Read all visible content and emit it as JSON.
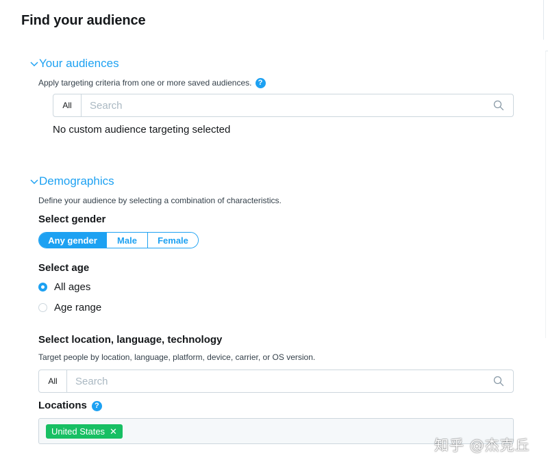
{
  "page": {
    "title": "Find your audience"
  },
  "audiences": {
    "header": "Your audiences",
    "help_text": "Apply targeting criteria from one or more saved audiences.",
    "search": {
      "scope": "All",
      "placeholder": "Search"
    },
    "empty_text": "No custom audience targeting selected"
  },
  "demographics": {
    "header": "Demographics",
    "help_text": "Define your audience by selecting a combination of characteristics.",
    "gender": {
      "label": "Select gender",
      "options": [
        "Any gender",
        "Male",
        "Female"
      ],
      "selected": "Any gender"
    },
    "age": {
      "label": "Select age",
      "options": [
        "All ages",
        "Age range"
      ],
      "selected": "All ages"
    }
  },
  "location": {
    "label": "Select location, language, technology",
    "help_text": "Target people by location, language, platform, device, carrier, or OS version.",
    "search": {
      "scope": "All",
      "placeholder": "Search"
    },
    "locations_label": "Locations",
    "selected_locations": [
      "United States"
    ]
  },
  "watermark": "知乎 @杰克丘",
  "colors": {
    "accent": "#1da1f2",
    "token": "#17bf63",
    "text": "#14171a",
    "muted": "#34404a"
  },
  "icons": {
    "chevron": "chevron-down-icon",
    "help": "help-icon",
    "search": "search-icon",
    "remove": "close-icon"
  }
}
